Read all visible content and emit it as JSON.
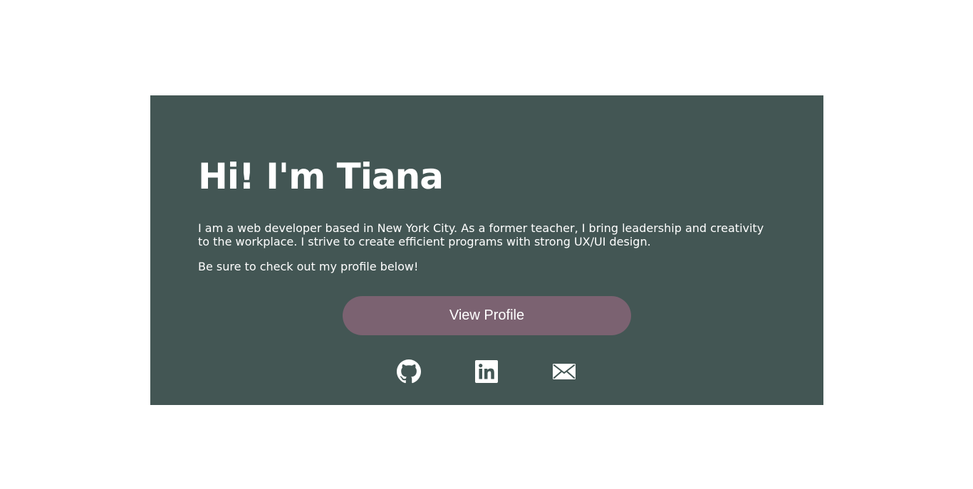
{
  "hero": {
    "title": "Hi! I'm Tiana",
    "bio": "I am a web developer based in New York City. As a former teacher, I bring leadership and creativity to the workplace. I strive to create efficient programs with strong UX/UI design.",
    "cta_text": "Be sure to check out my profile below!",
    "button_label": "View Profile"
  },
  "social": {
    "icons": [
      "github-icon",
      "linkedin-icon",
      "mail-icon"
    ]
  },
  "colors": {
    "card_background": "#435654",
    "button_background": "#7b6271",
    "text": "#ffffff"
  }
}
